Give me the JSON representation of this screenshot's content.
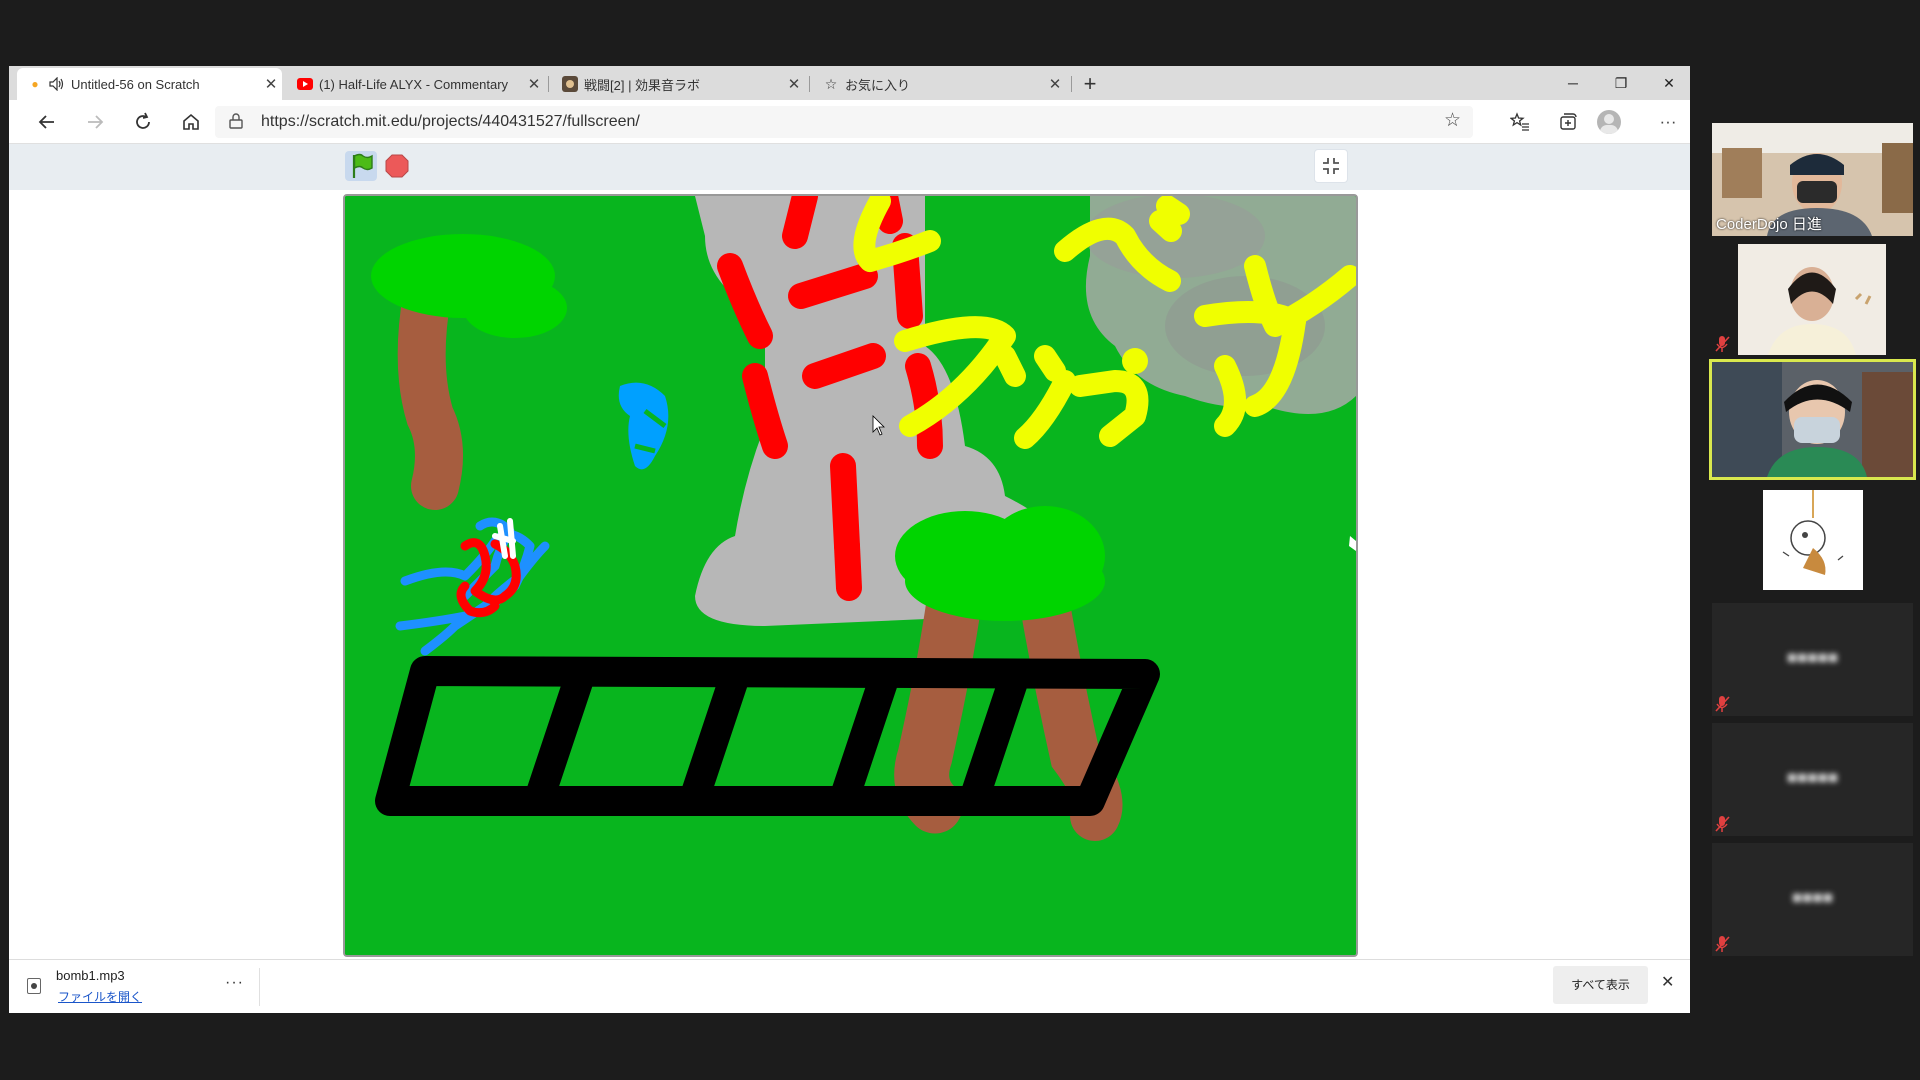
{
  "browser": {
    "tabs": [
      {
        "title": "Untitled-56 on Scratch",
        "favicon": "scratch-cat-icon",
        "audio": true,
        "active": true
      },
      {
        "title": "(1) Half-Life ALYX - Commentary",
        "favicon": "youtube-icon",
        "active": false
      },
      {
        "title": "戦闘[2] | 効果音ラボ",
        "favicon": "soundlab-icon",
        "active": false
      },
      {
        "title": "お気に入り",
        "favicon": "favorites-star-icon",
        "active": false
      }
    ],
    "new_tab_label": "+",
    "window_controls": {
      "minimize": "─",
      "restore": "❐",
      "close": "✕"
    },
    "address": "https://scratch.mit.edu/projects/440431527/fullscreen/"
  },
  "scratch": {
    "green_flag": "green-flag-icon",
    "stop": "stop-sign-icon",
    "stage_overlay_text": "レベルアップ"
  },
  "download_bar": {
    "filename": "bomb1.mp3",
    "open_link": "ファイルを開く",
    "more": "···",
    "show_all": "すべて表示",
    "close": "✕"
  },
  "participants": [
    {
      "name": "CoderDojo 日進",
      "muted": false
    },
    {
      "name": "",
      "muted": true
    },
    {
      "name": "",
      "muted": false,
      "active_speaker": true
    },
    {
      "name": "",
      "muted": false
    },
    {
      "name": "",
      "muted": true,
      "blurred": true
    },
    {
      "name": "",
      "muted": true,
      "blurred": true
    },
    {
      "name": "",
      "muted": true,
      "blurred": true
    }
  ],
  "colors": {
    "stage_green": "#08b51e",
    "active_speaker_border": "#d9e84e",
    "link": "#1a55c9"
  }
}
